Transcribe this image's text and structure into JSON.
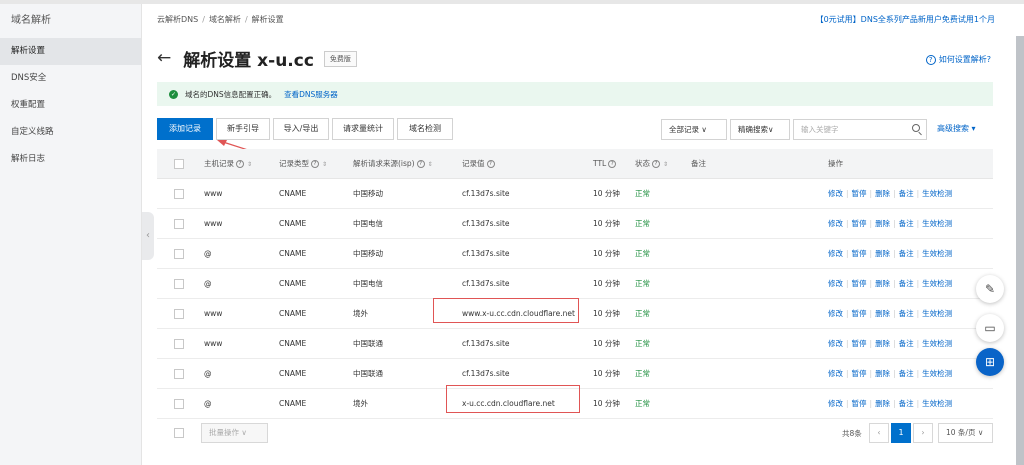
{
  "sidebar": {
    "title": "域名解析",
    "items": [
      {
        "label": "解析设置",
        "active": true
      },
      {
        "label": "DNS安全",
        "active": false
      },
      {
        "label": "权重配置",
        "active": false
      },
      {
        "label": "自定义线路",
        "active": false
      },
      {
        "label": "解析日志",
        "active": false
      }
    ]
  },
  "breadcrumb": [
    "云解析DNS",
    "域名解析",
    "解析设置"
  ],
  "promo": "【0元试用】DNS全系列产品新用户免费试用1个月",
  "header": {
    "title": "解析设置 x-u.cc",
    "badge": "免费版",
    "help": "如何设置解析?"
  },
  "notice": {
    "text": "域名的DNS信息配置正确。",
    "link": "查看DNS服务器"
  },
  "toolbar": {
    "add": "添加记录",
    "guide": "新手引导",
    "import_export": "导入/导出",
    "stats": "请求量统计",
    "check": "域名检测",
    "filter_all": "全部记录",
    "precise": "精确搜索",
    "search_placeholder": "输入关键字",
    "advanced": "高级搜索"
  },
  "table": {
    "headers": {
      "host": "主机记录",
      "type": "记录类型",
      "line": "解析请求来源(isp)",
      "value": "记录值",
      "ttl": "TTL",
      "status": "状态",
      "remark": "备注",
      "ops": "操作"
    },
    "rows": [
      {
        "host": "www",
        "type": "CNAME",
        "line": "中国移动",
        "value": "cf.13d7s.site",
        "ttl": "10 分钟",
        "status": "正常"
      },
      {
        "host": "www",
        "type": "CNAME",
        "line": "中国电信",
        "value": "cf.13d7s.site",
        "ttl": "10 分钟",
        "status": "正常"
      },
      {
        "host": "@",
        "type": "CNAME",
        "line": "中国移动",
        "value": "cf.13d7s.site",
        "ttl": "10 分钟",
        "status": "正常"
      },
      {
        "host": "@",
        "type": "CNAME",
        "line": "中国电信",
        "value": "cf.13d7s.site",
        "ttl": "10 分钟",
        "status": "正常"
      },
      {
        "host": "www",
        "type": "CNAME",
        "line": "境外",
        "value": "www.x-u.cc.cdn.cloudflare.net",
        "ttl": "10 分钟",
        "status": "正常"
      },
      {
        "host": "www",
        "type": "CNAME",
        "line": "中国联通",
        "value": "cf.13d7s.site",
        "ttl": "10 分钟",
        "status": "正常"
      },
      {
        "host": "@",
        "type": "CNAME",
        "line": "中国联通",
        "value": "cf.13d7s.site",
        "ttl": "10 分钟",
        "status": "正常"
      },
      {
        "host": "@",
        "type": "CNAME",
        "line": "境外",
        "value": "x-u.cc.cdn.cloudflare.net",
        "ttl": "10 分钟",
        "status": "正常"
      }
    ],
    "ops": [
      "修改",
      "暂停",
      "删除",
      "备注",
      "生效检测"
    ]
  },
  "footer": {
    "batch": "批量操作",
    "total": "共8条",
    "page": "1",
    "page_size": "10 条/页"
  },
  "colors": {
    "primary": "#0070cc",
    "link": "#0064c8",
    "ok": "#1e8e3e",
    "highlight": "#e05555"
  }
}
